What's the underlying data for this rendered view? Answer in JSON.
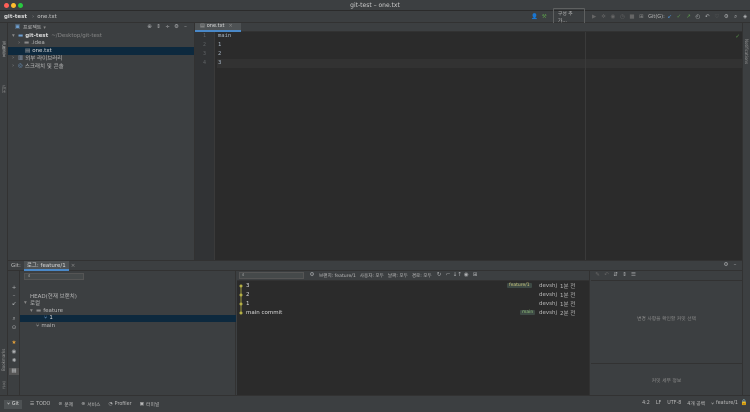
{
  "window": {
    "title": "git-test – one.txt"
  },
  "navbar": {
    "project": "git-test",
    "file": "one.txt",
    "run_config": "구성 추가...",
    "git_label": "Git(G):"
  },
  "left_strip": {
    "project_label": "프로젝트",
    "commit_label": "커밋",
    "bookmarks_label": "Bookmarks",
    "structure_label": "구조"
  },
  "right_strip": {
    "notifications_label": "Notifications"
  },
  "project_panel": {
    "header": "프로젝트",
    "tree": [
      {
        "name": "git-test",
        "path": "~/Desktop/git-test"
      },
      {
        "name": ".idea"
      },
      {
        "name": "one.txt"
      },
      {
        "name": "외부 라이브러리"
      },
      {
        "name": "스크래치 및 콘솔"
      }
    ]
  },
  "editor": {
    "tab": "one.txt",
    "lines": [
      "main",
      "1",
      "2",
      "3"
    ],
    "line_numbers": [
      "1",
      "2",
      "3",
      "4"
    ]
  },
  "git_panel": {
    "label": "Git:",
    "tab": "로그: feature/1",
    "branches": {
      "head": "HEAD(현재 브랜치)",
      "local": "로컬",
      "folder": "feature",
      "feature_branch": "1",
      "main": "main"
    },
    "filters": {
      "branch": "브랜치: feature/1",
      "user": "사용자: 모두",
      "date": "날짜: 모두",
      "path": "경로: 모두"
    },
    "commits": [
      {
        "message": "3",
        "tag": "feature/1",
        "author": "devshj",
        "time": "1분 전"
      },
      {
        "message": "2",
        "tag": "",
        "author": "devshj",
        "time": "1분 전"
      },
      {
        "message": "1",
        "tag": "",
        "author": "devshj",
        "time": "1분 전"
      },
      {
        "message": "main commit",
        "tag": "main",
        "author": "devshj",
        "time": "2분 전"
      }
    ],
    "details_hint": "변경 사항을 확인할 커밋 선택",
    "details_footer": "커밋 세부 정보"
  },
  "statusbar": {
    "items": [
      "Git",
      "TODO",
      "문제",
      "서비스",
      "Profiler",
      "터미널"
    ],
    "position": "4:2",
    "line_sep": "LF",
    "encoding": "UTF-8",
    "indent": "4개 공백",
    "branch": "feature/1"
  }
}
